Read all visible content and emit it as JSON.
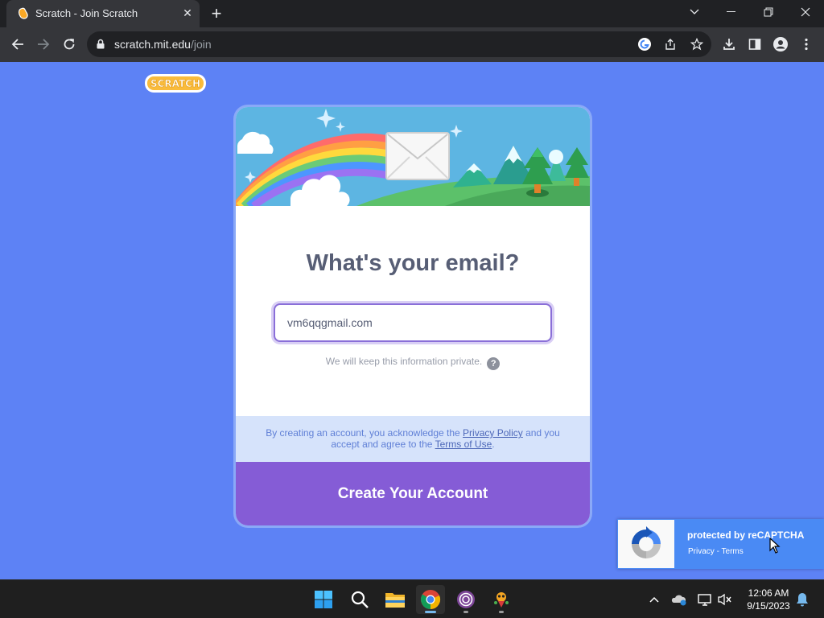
{
  "browser": {
    "tab_title": "Scratch - Join Scratch",
    "url_host": "scratch.mit.edu",
    "url_path": "/join"
  },
  "page": {
    "logo_text": "SCRATCH",
    "heading": "What's your email?",
    "email_value": "vm6qqgmail.com",
    "privacy_note": "We will keep this information private.",
    "legal": {
      "part1": "By creating an account, you acknowledge the ",
      "privacy_link": "Privacy Policy",
      "part2": " and you accept and agree to the ",
      "terms_link": "Terms of Use",
      "part3": "."
    },
    "create_button": "Create Your Account",
    "background_color": "#5d82f5",
    "accent_color": "#855cd6"
  },
  "recaptcha": {
    "title": "protected by reCAPTCHA",
    "privacy": "Privacy",
    "separator": " - ",
    "terms": "Terms"
  },
  "taskbar": {
    "apps": [
      "start-icon",
      "search-icon",
      "file-explorer-icon",
      "chrome-icon",
      "tor-browser-icon",
      "scratch-app-icon"
    ],
    "time": "12:06 AM",
    "date": "9/15/2023"
  }
}
